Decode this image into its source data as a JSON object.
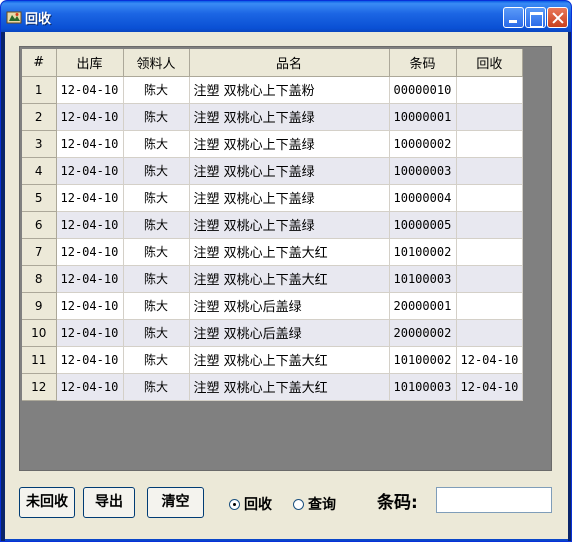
{
  "window": {
    "title": "回收"
  },
  "table": {
    "columns": [
      "#",
      "出库",
      "领料人",
      "品名",
      "条码",
      "回收"
    ],
    "rows": [
      {
        "no": "1",
        "out": "12-04-10",
        "person": "陈大",
        "name": "注塑 双桃心上下盖粉",
        "code": "00000010",
        "recv": ""
      },
      {
        "no": "2",
        "out": "12-04-10",
        "person": "陈大",
        "name": "注塑 双桃心上下盖绿",
        "code": "10000001",
        "recv": ""
      },
      {
        "no": "3",
        "out": "12-04-10",
        "person": "陈大",
        "name": "注塑 双桃心上下盖绿",
        "code": "10000002",
        "recv": ""
      },
      {
        "no": "4",
        "out": "12-04-10",
        "person": "陈大",
        "name": "注塑 双桃心上下盖绿",
        "code": "10000003",
        "recv": ""
      },
      {
        "no": "5",
        "out": "12-04-10",
        "person": "陈大",
        "name": "注塑 双桃心上下盖绿",
        "code": "10000004",
        "recv": ""
      },
      {
        "no": "6",
        "out": "12-04-10",
        "person": "陈大",
        "name": "注塑 双桃心上下盖绿",
        "code": "10000005",
        "recv": ""
      },
      {
        "no": "7",
        "out": "12-04-10",
        "person": "陈大",
        "name": "注塑 双桃心上下盖大红",
        "code": "10100002",
        "recv": ""
      },
      {
        "no": "8",
        "out": "12-04-10",
        "person": "陈大",
        "name": "注塑 双桃心上下盖大红",
        "code": "10100003",
        "recv": ""
      },
      {
        "no": "9",
        "out": "12-04-10",
        "person": "陈大",
        "name": "注塑 双桃心后盖绿",
        "code": "20000001",
        "recv": ""
      },
      {
        "no": "10",
        "out": "12-04-10",
        "person": "陈大",
        "name": "注塑 双桃心后盖绿",
        "code": "20000002",
        "recv": ""
      },
      {
        "no": "11",
        "out": "12-04-10",
        "person": "陈大",
        "name": "注塑 双桃心上下盖大红",
        "code": "10100002",
        "recv": "12-04-10"
      },
      {
        "no": "12",
        "out": "12-04-10",
        "person": "陈大",
        "name": "注塑 双桃心上下盖大红",
        "code": "10100003",
        "recv": "12-04-10"
      }
    ]
  },
  "buttons": {
    "not_recycled": "未回收",
    "export": "导出",
    "clear": "清空"
  },
  "radios": {
    "recycle": "回收",
    "query": "查询",
    "selected": "回收"
  },
  "barcode": {
    "label": "条码:",
    "value": ""
  },
  "colors": {
    "titlebar": "#0a50d4",
    "client": "#ece9d8",
    "grid_background": "#808080",
    "alt_row": "#e8e8f0"
  }
}
